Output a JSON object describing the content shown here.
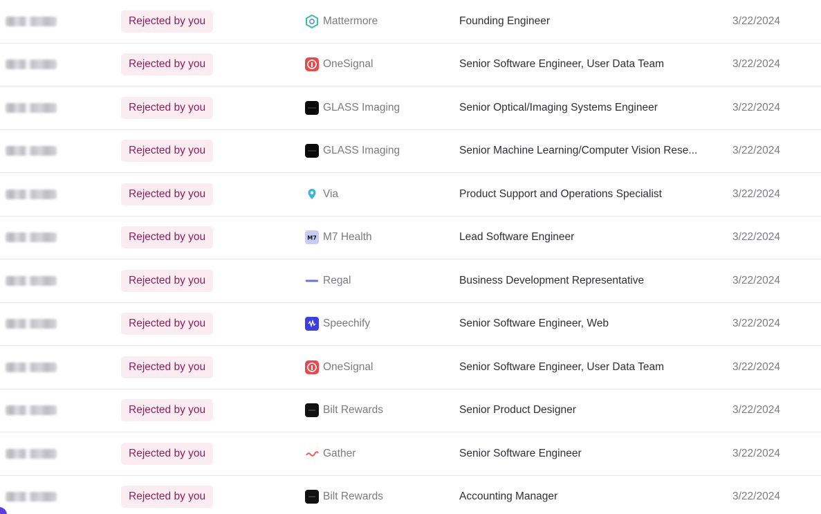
{
  "rows": [
    {
      "status": "Rejected by you",
      "company": "Mattermore",
      "logo": "mattermore-logo",
      "title": "Founding Engineer",
      "date": "3/22/2024"
    },
    {
      "status": "Rejected by you",
      "company": "OneSignal",
      "logo": "onesignal-logo",
      "title": "Senior Software Engineer, User Data Team",
      "date": "3/22/2024"
    },
    {
      "status": "Rejected by you",
      "company": "GLASS Imaging",
      "logo": "glass-imaging-logo",
      "title": "Senior Optical/Imaging Systems Engineer",
      "date": "3/22/2024"
    },
    {
      "status": "Rejected by you",
      "company": "GLASS Imaging",
      "logo": "glass-imaging-logo",
      "title": "Senior Machine Learning/Computer Vision Rese...",
      "date": "3/22/2024"
    },
    {
      "status": "Rejected by you",
      "company": "Via",
      "logo": "via-pin-logo",
      "title": "Product Support and Operations Specialist",
      "date": "3/22/2024"
    },
    {
      "status": "Rejected by you",
      "company": "M7 Health",
      "logo": "m7-health-logo",
      "title": "Lead Software Engineer",
      "date": "3/22/2024"
    },
    {
      "status": "Rejected by you",
      "company": "Regal",
      "logo": "regal-logo",
      "title": "Business Development Representative",
      "date": "3/22/2024"
    },
    {
      "status": "Rejected by you",
      "company": "Speechify",
      "logo": "speechify-logo",
      "title": "Senior Software Engineer, Web",
      "date": "3/22/2024"
    },
    {
      "status": "Rejected by you",
      "company": "OneSignal",
      "logo": "onesignal-logo",
      "title": "Senior Software Engineer, User Data Team",
      "date": "3/22/2024"
    },
    {
      "status": "Rejected by you",
      "company": "Bilt Rewards",
      "logo": "bilt-rewards-logo",
      "title": "Senior Product Designer",
      "date": "3/22/2024"
    },
    {
      "status": "Rejected by you",
      "company": "Gather",
      "logo": "gather-logo",
      "title": "Senior Software Engineer",
      "date": "3/22/2024"
    },
    {
      "status": "Rejected by you",
      "company": "Bilt Rewards",
      "logo": "bilt-rewards-logo",
      "title": "Accounting Manager",
      "date": "3/22/2024"
    }
  ],
  "colors": {
    "badge_bg": "#fbecf2",
    "badge_text": "#8c1f5b",
    "muted_text": "#7a7a85",
    "body_text": "#2e2e36",
    "divider": "#e8e8ee"
  }
}
